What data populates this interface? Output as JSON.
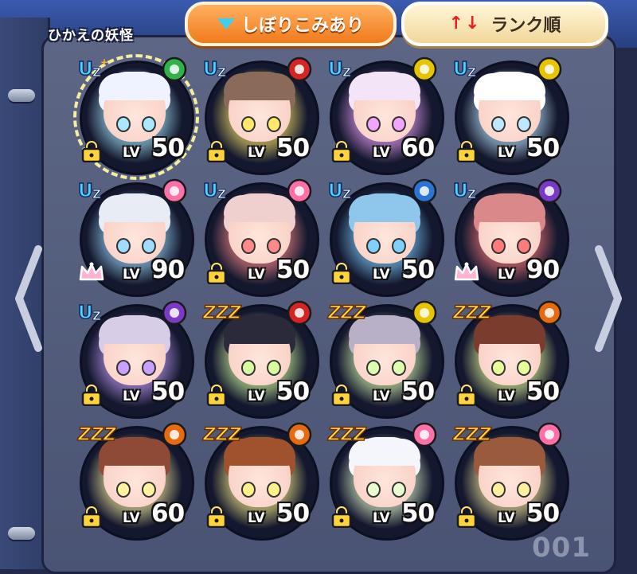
{
  "header": {
    "title": "ひかえの妖怪",
    "filter_label": "しぼりこみあり",
    "sort_label": "ランク順"
  },
  "icons": {
    "filter": "funnel-icon",
    "sort": "sort-arrows-icon",
    "nav_left": "chevron-left-icon",
    "nav_right": "chevron-right-icon"
  },
  "level_prefix": "LV",
  "page_number": "001",
  "colors": {
    "filter_button": "#f07a1c",
    "sort_button": "#f1d79a",
    "panel": "#4a5373",
    "level_text": "#ffffff"
  },
  "yokai": [
    {
      "rank": "UZ+",
      "tribe": "pretty",
      "level": "50",
      "locked": true,
      "selected": true,
      "glow": "#a8e9ff",
      "hair": "#eef3ff"
    },
    {
      "rank": "UZ",
      "tribe": "brave",
      "level": "50",
      "locked": true,
      "selected": false,
      "glow": "#ffe86a",
      "hair": "#8a6a58"
    },
    {
      "rank": "UZ",
      "tribe": "mysterious",
      "level": "60",
      "locked": true,
      "selected": false,
      "glow": "#f3a4ff",
      "hair": "#f3e4f8"
    },
    {
      "rank": "UZ",
      "tribe": "mysterious",
      "level": "50",
      "locked": true,
      "selected": false,
      "glow": "#bfe8ff",
      "hair": "#ffffff"
    },
    {
      "rank": "UZ",
      "tribe": "charming",
      "level": "90",
      "locked": false,
      "selected": false,
      "glow": "#9fdcff",
      "hair": "#e8ecf4"
    },
    {
      "rank": "UZ",
      "tribe": "charming",
      "level": "50",
      "locked": true,
      "selected": false,
      "glow": "#ff8a8a",
      "hair": "#f0d0cf"
    },
    {
      "rank": "UZ",
      "tribe": "slippery",
      "level": "50",
      "locked": true,
      "selected": false,
      "glow": "#7fd0ff",
      "hair": "#8ec6ec"
    },
    {
      "rank": "UZ",
      "tribe": "eerie",
      "level": "90",
      "locked": false,
      "selected": false,
      "glow": "#ff7a7a",
      "hair": "#d9898a"
    },
    {
      "rank": "UZ",
      "tribe": "eerie",
      "level": "50",
      "locked": true,
      "selected": false,
      "glow": "#c9a0ff",
      "hair": "#d8cde6"
    },
    {
      "rank": "ZZZ",
      "tribe": "brave",
      "level": "50",
      "locked": true,
      "selected": false,
      "glow": "#d7ffa0",
      "hair": "#2a2a3a"
    },
    {
      "rank": "ZZZ",
      "tribe": "mysterious",
      "level": "50",
      "locked": true,
      "selected": false,
      "glow": "#dfffb0",
      "hair": "#b7b0c7"
    },
    {
      "rank": "ZZZ",
      "tribe": "tough",
      "level": "50",
      "locked": true,
      "selected": false,
      "glow": "#e9ff9a",
      "hair": "#7a3c2c"
    },
    {
      "rank": "ZZZ",
      "tribe": "tough",
      "level": "60",
      "locked": true,
      "selected": false,
      "glow": "#fff3a0",
      "hair": "#8e4a36"
    },
    {
      "rank": "ZZZ",
      "tribe": "tough",
      "level": "50",
      "locked": true,
      "selected": false,
      "glow": "#fff28a",
      "hair": "#a0522d"
    },
    {
      "rank": "ZZZ",
      "tribe": "charming",
      "level": "50",
      "locked": true,
      "selected": false,
      "glow": "#e8ffd0",
      "hair": "#f4f6fb"
    },
    {
      "rank": "ZZZ",
      "tribe": "charming",
      "level": "50",
      "locked": true,
      "selected": false,
      "glow": "#fff0a0",
      "hair": "#9a5a3e"
    }
  ]
}
